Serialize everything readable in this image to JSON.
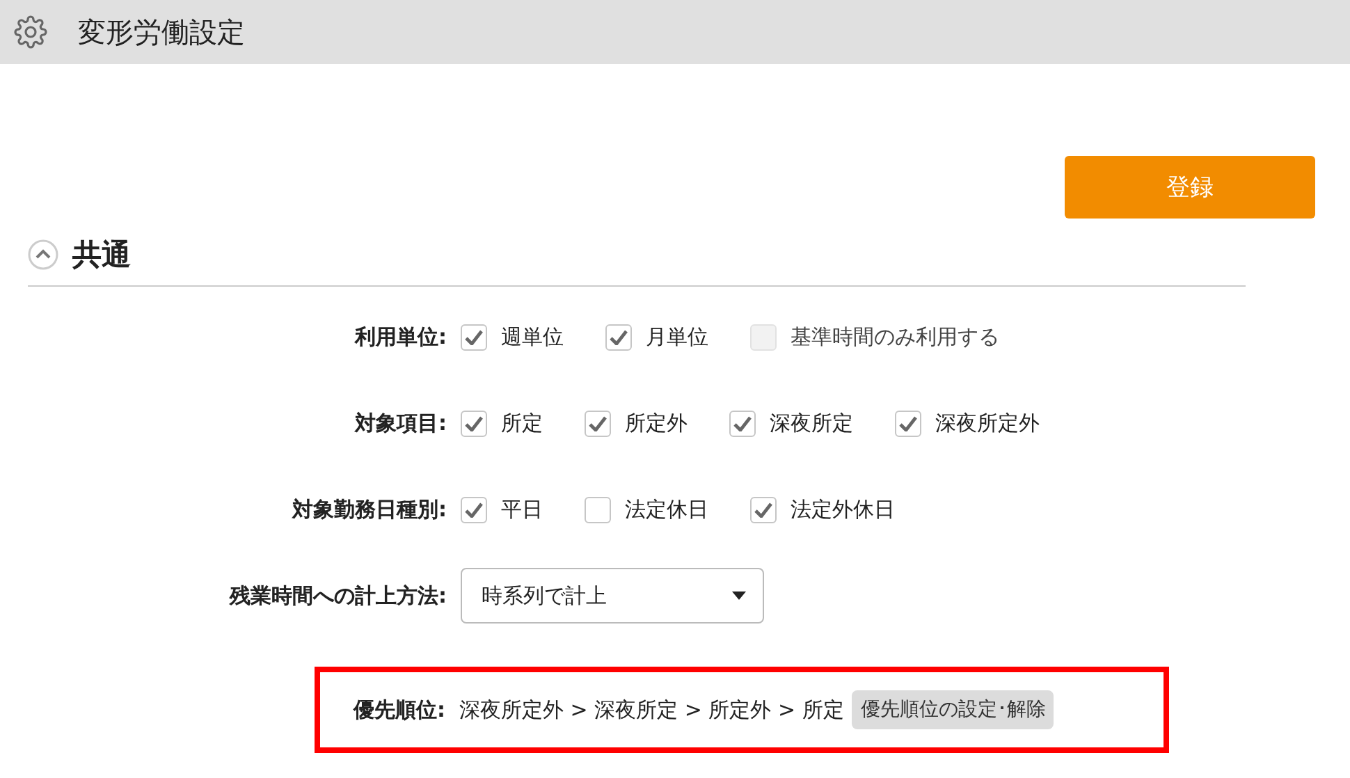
{
  "header": {
    "title": "変形労働設定"
  },
  "register_button": "登録",
  "section": {
    "title": "共通",
    "expanded": true
  },
  "rows": [
    {
      "kind": "checks",
      "label": "利用単位:",
      "options": [
        {
          "label": "週単位",
          "checked": true,
          "disabled": false
        },
        {
          "label": "月単位",
          "checked": true,
          "disabled": false
        },
        {
          "label": "基準時間のみ利用する",
          "checked": false,
          "disabled": true
        }
      ]
    },
    {
      "kind": "checks",
      "label": "対象項目:",
      "options": [
        {
          "label": "所定",
          "checked": true,
          "disabled": false
        },
        {
          "label": "所定外",
          "checked": true,
          "disabled": false
        },
        {
          "label": "深夜所定",
          "checked": true,
          "disabled": false
        },
        {
          "label": "深夜所定外",
          "checked": true,
          "disabled": false
        }
      ]
    },
    {
      "kind": "checks",
      "label": "対象勤務日種別:",
      "options": [
        {
          "label": "平日",
          "checked": true,
          "disabled": false
        },
        {
          "label": "法定休日",
          "checked": false,
          "disabled": false
        },
        {
          "label": "法定外休日",
          "checked": true,
          "disabled": false
        }
      ]
    },
    {
      "kind": "select",
      "label": "残業時間への計上方法:",
      "value": "時系列で計上"
    }
  ],
  "priority": {
    "label": "優先順位:",
    "order": "深夜所定外 > 深夜所定 > 所定外 > 所定",
    "button": "優先順位の設定･解除"
  }
}
